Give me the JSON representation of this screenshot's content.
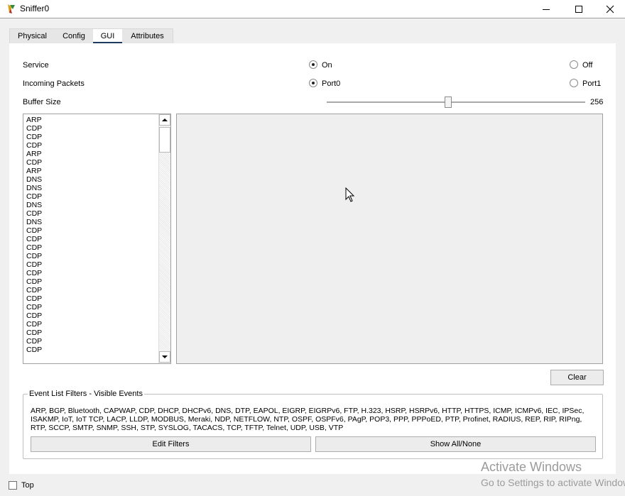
{
  "window": {
    "title": "Sniffer0"
  },
  "tabs": [
    {
      "label": "Physical"
    },
    {
      "label": "Config"
    },
    {
      "label": "GUI"
    },
    {
      "label": "Attributes"
    }
  ],
  "active_tab": "GUI",
  "service": {
    "label": "Service",
    "on_label": "On",
    "off_label": "Off",
    "selected": "On"
  },
  "incoming": {
    "label": "Incoming Packets",
    "port0_label": "Port0",
    "port1_label": "Port1",
    "selected": "Port0"
  },
  "buffer": {
    "label": "Buffer Size",
    "value": "256",
    "slider_fraction": 0.47
  },
  "packets": [
    "ARP",
    "CDP",
    "CDP",
    "CDP",
    "ARP",
    "CDP",
    "ARP",
    "DNS",
    "DNS",
    "CDP",
    "DNS",
    "CDP",
    "DNS",
    "CDP",
    "CDP",
    "CDP",
    "CDP",
    "CDP",
    "CDP",
    "CDP",
    "CDP",
    "CDP",
    "CDP",
    "CDP",
    "CDP",
    "CDP",
    "CDP",
    "CDP"
  ],
  "buttons": {
    "clear": "Clear",
    "edit_filters": "Edit Filters",
    "show_all_none": "Show All/None"
  },
  "filters": {
    "legend": "Event List Filters - Visible Events",
    "text": "ARP, BGP, Bluetooth, CAPWAP, CDP, DHCP, DHCPv6, DNS, DTP, EAPOL, EIGRP, EIGRPv6, FTP, H.323, HSRP, HSRPv6, HTTP, HTTPS, ICMP, ICMPv6, IEC, IPSec, ISAKMP, IoT, IoT TCP, LACP, LLDP, MODBUS, Meraki, NDP, NETFLOW, NTP, OSPF, OSPFv6, PAgP, POP3, PPP, PPPoED, PTP, Profinet, RADIUS, REP, RIP, RIPng, RTP, SCCP, SMTP, SNMP, SSH, STP, SYSLOG, TACACS, TCP, TFTP, Telnet, UDP, USB, VTP"
  },
  "footer": {
    "top_label": "Top",
    "top_checked": false
  },
  "watermark": {
    "line1": "Activate Windows",
    "line2": "Go to Settings to activate Windows."
  },
  "colors": {
    "tab_underline": "#1e3a5f",
    "panel_bg": "#ffffff",
    "window_bg": "#f0f0f0",
    "detail_bg": "#efefef"
  }
}
